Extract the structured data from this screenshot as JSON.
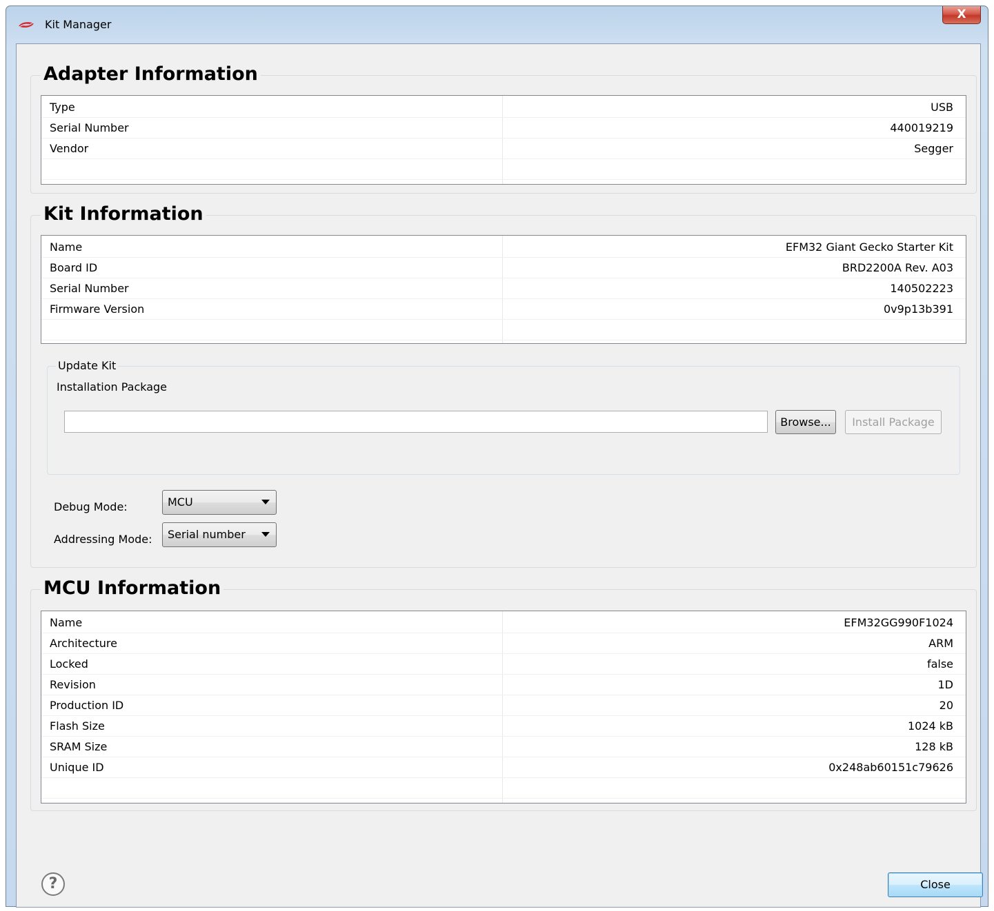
{
  "window": {
    "title": "Kit Manager",
    "close_glyph": "X"
  },
  "adapter": {
    "title": "Adapter Information",
    "rows": [
      {
        "key": "Type",
        "value": "USB"
      },
      {
        "key": "Serial Number",
        "value": "440019219"
      },
      {
        "key": "Vendor",
        "value": "Segger"
      }
    ]
  },
  "kit": {
    "title": "Kit Information",
    "rows": [
      {
        "key": "Name",
        "value": "EFM32 Giant Gecko Starter Kit"
      },
      {
        "key": "Board ID",
        "value": "BRD2200A Rev. A03"
      },
      {
        "key": "Serial Number",
        "value": "140502223"
      },
      {
        "key": "Firmware Version",
        "value": "0v9p13b391"
      }
    ],
    "update": {
      "title": "Update Kit",
      "package_label": "Installation Package",
      "package_value": "",
      "browse_label": "Browse...",
      "install_label": "Install Package"
    },
    "debug_mode_label": "Debug Mode:",
    "debug_mode_value": "MCU",
    "addressing_mode_label": "Addressing Mode:",
    "addressing_mode_value": "Serial number"
  },
  "mcu": {
    "title": "MCU Information",
    "rows": [
      {
        "key": "Name",
        "value": "EFM32GG990F1024"
      },
      {
        "key": "Architecture",
        "value": "ARM"
      },
      {
        "key": "Locked",
        "value": "false"
      },
      {
        "key": "Revision",
        "value": "1D"
      },
      {
        "key": "Production ID",
        "value": "20"
      },
      {
        "key": "Flash Size",
        "value": "1024 kB"
      },
      {
        "key": "SRAM Size",
        "value": "128 kB"
      },
      {
        "key": "Unique ID",
        "value": "0x248ab60151c79626"
      }
    ]
  },
  "footer": {
    "help_glyph": "?",
    "close_label": "Close"
  },
  "icons": {
    "app": "silicon-labs-logo-icon",
    "help": "help-icon",
    "close": "close-icon",
    "dropdown": "chevron-down-icon"
  }
}
